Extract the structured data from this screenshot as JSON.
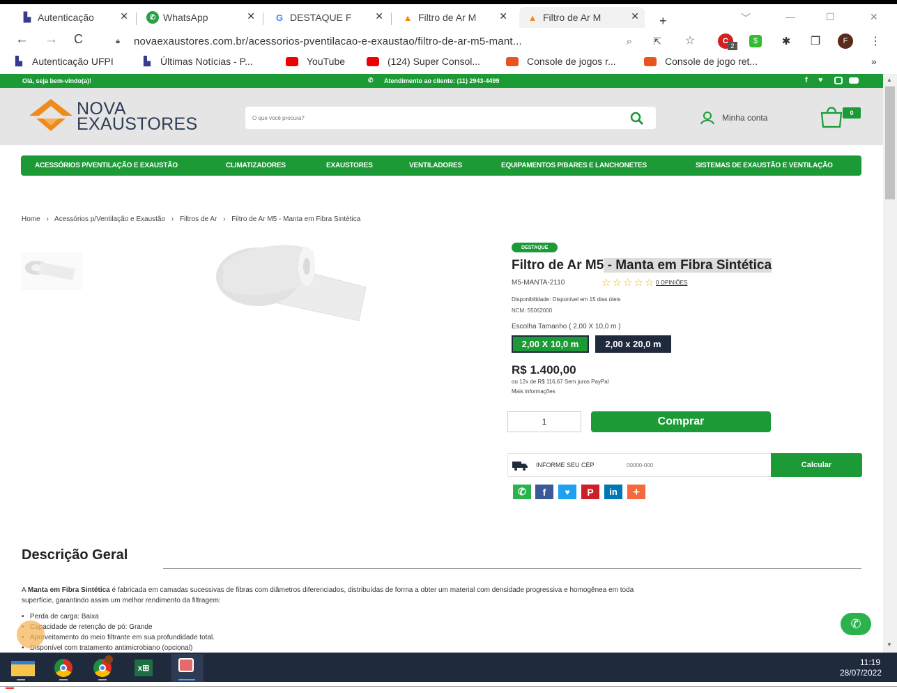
{
  "browser": {
    "tabs": [
      {
        "title": "Autenticação",
        "icon": "ufpi-icon"
      },
      {
        "title": "WhatsApp",
        "icon": "whatsapp-icon"
      },
      {
        "title": "DESTAQUE F",
        "icon": "google-icon"
      },
      {
        "title": "Filtro de Ar M",
        "icon": "nova-exaustores-icon"
      },
      {
        "title": "Filtro de Ar M",
        "icon": "nova-exaustores-icon"
      }
    ],
    "url": "novaexaustores.com.br/acessorios-pventilacao-e-exaustao/filtro-de-ar-m5-mant...",
    "profile_initial": "F",
    "extension_badge": "2",
    "bookmarks": [
      {
        "label": "Autenticação UFPI",
        "icon": "ufpi-icon"
      },
      {
        "label": "Últimas Notícias - P...",
        "icon": "ufpi-icon"
      },
      {
        "label": "YouTube",
        "icon": "youtube-icon"
      },
      {
        "label": "(124) Super Consol...",
        "icon": "youtube-icon"
      },
      {
        "label": "Console de jogos r...",
        "icon": "shop-icon"
      },
      {
        "label": "Console de jogo ret...",
        "icon": "shop-icon"
      }
    ],
    "more_bookmarks": "»"
  },
  "site": {
    "welcome": "Olá, seja bem-vindo(a)!",
    "support": "Atendimento ao cliente: (11) 2943-4499",
    "logo_line1": "NOVA",
    "logo_line2": "EXAUSTORES",
    "search_placeholder": "O que você procura?",
    "account_label": "Minha conta",
    "cart_count": "0",
    "menu": [
      "ACESSÓRIOS P/VENTILAÇÃO E EXAUSTÃO",
      "CLIMATIZADORES",
      "EXAUSTORES",
      "VENTILADORES",
      "EQUIPAMENTOS P/BARES E LANCHONETES",
      "SISTEMAS DE EXAUSTÃO E VENTILAÇÃO"
    ],
    "breadcrumb": [
      "Home",
      "Acessórios p/Ventilação e Exaustão",
      "Filtros de Ar",
      "Filtro de Ar M5 - Manta em Fibra Sintética"
    ],
    "breadcrumb_sep": "›"
  },
  "product": {
    "badge": "DESTAQUE",
    "title_part1": "Filtro de Ar M5",
    "title_part2": " - Manta em Fibra Sintética",
    "sku": "M5-MANTA-2110",
    "rating": 0,
    "stars_max": 5,
    "reviews": "0 OPINIÕES",
    "availability": "Disponibilidade: Disponível em 15 dias úteis",
    "ncm": "NCM: 55062000",
    "size_label": "Escolha Tamanho ( 2,00 X 10,0 m )",
    "sizes": [
      "2,00 X 10,0 m",
      "2,00 x 20,0 m"
    ],
    "price": "R$ 1.400,00",
    "installments": "ou 12x de R$ 116,67 Sem juros PayPal",
    "more_info": "Mais informações",
    "quantity": "1",
    "buy_label": "Comprar",
    "cep_label": "INFORME SEU CEP",
    "cep_placeholder": "00000-000",
    "calc_label": "Calcular",
    "share_icons": [
      "whatsapp-share-icon",
      "facebook-share-icon",
      "twitter-share-icon",
      "pinterest-share-icon",
      "linkedin-share-icon",
      "more-share-icon"
    ]
  },
  "description": {
    "heading": "Descrição Geral",
    "intro_bold": "Manta em Fibra Sintética",
    "intro_pre": "A ",
    "intro_rest": " é fabricada em camadas sucessivas de fibras com diâmetros diferenciados, distribuídas de forma a obter um material com densidade progressiva e homogênea em toda",
    "intro_line2": "superfície, garantindo assim um melhor rendimento da filtragem:",
    "bullets": [
      "Perda de carga: Baixa",
      "Capacidade de retenção de pó: Grande",
      "Aproveitamento do meio filtrante em sua profundidade total.",
      "Disponível com tratamento antimicrobiano (opcional)"
    ]
  },
  "taskbar": {
    "time": "11:19",
    "date": "28/07/2022",
    "apps": [
      "file-explorer-icon",
      "chrome-icon",
      "chrome-profile-icon",
      "excel-icon",
      "snipping-tool-icon"
    ]
  }
}
